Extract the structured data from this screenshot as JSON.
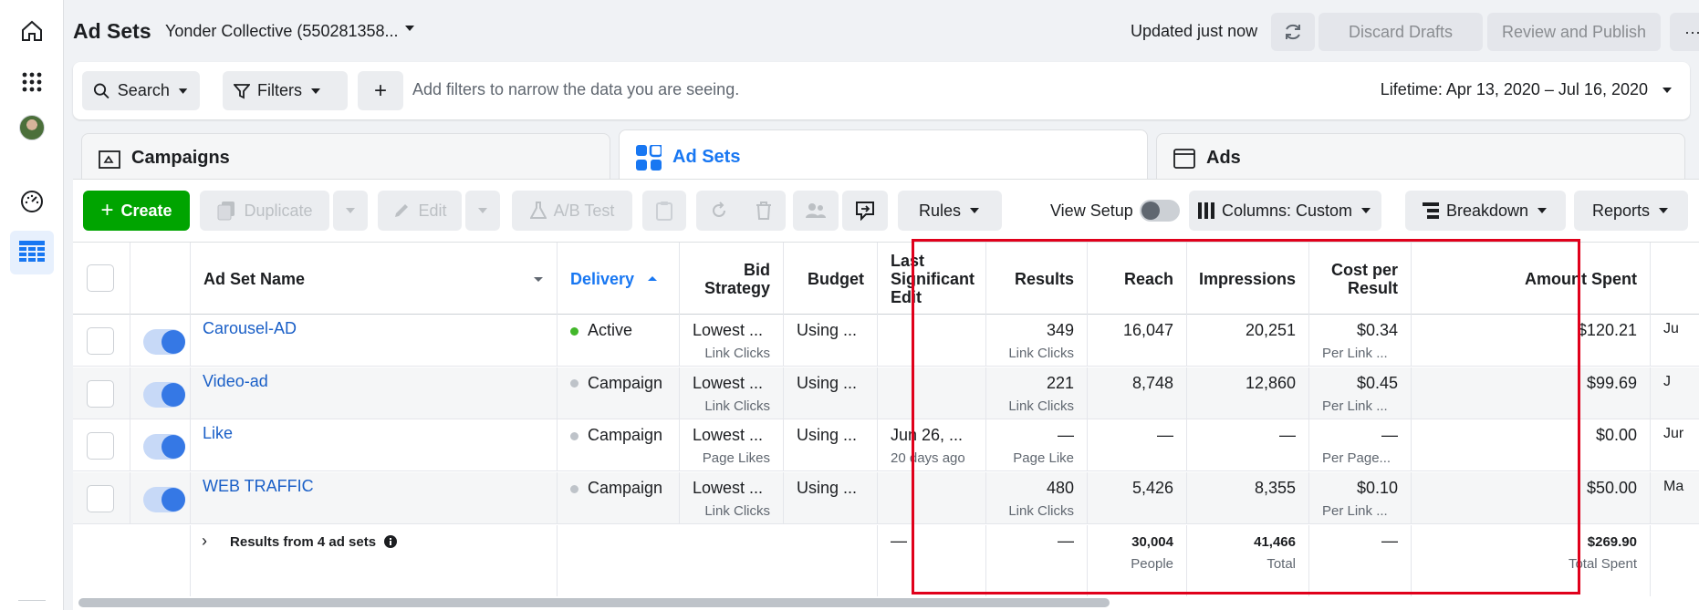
{
  "header": {
    "title": "Ad Sets",
    "account": "Yonder Collective (550281358...",
    "status": "Updated just now",
    "discard_label": "Discard Drafts",
    "review_label": "Review and Publish",
    "more_label": "···"
  },
  "filters": {
    "search_label": "Search",
    "filters_label": "Filters",
    "add_label": "+",
    "hint": "Add filters to narrow the data you are seeing.",
    "date_range": "Lifetime: Apr 13, 2020 – Jul 16, 2020"
  },
  "tabs": [
    {
      "label": "Campaigns"
    },
    {
      "label": "Ad Sets"
    },
    {
      "label": "Ads"
    }
  ],
  "toolbar": {
    "create": "Create",
    "duplicate": "Duplicate",
    "edit": "Edit",
    "ab_test": "A/B Test",
    "rules": "Rules",
    "view_setup": "View Setup",
    "columns": "Columns: Custom",
    "breakdown": "Breakdown",
    "reports": "Reports"
  },
  "columns": {
    "name": "Ad Set Name",
    "delivery": "Delivery",
    "bid": "Bid Strategy",
    "budget": "Budget",
    "last_edit": "Last Significant Edit",
    "results": "Results",
    "reach": "Reach",
    "impressions": "Impressions",
    "cpr": "Cost per Result",
    "spent": "Amount Spent"
  },
  "rows": [
    {
      "name": "Carousel-AD",
      "delivery": "Active",
      "delivery_color": "#42b72a",
      "bid": "Lowest ...",
      "bid_sub": "Link Clicks",
      "budget": "Using ...",
      "edit": "",
      "edit_sub": "",
      "results": "349",
      "results_sub": "Link Clicks",
      "reach": "16,047",
      "impressions": "20,251",
      "cpr": "$0.34",
      "cpr_sub": "Per Link ...",
      "spent": "$120.21",
      "extra": "Ju"
    },
    {
      "name": "Video-ad",
      "delivery": "Campaign",
      "delivery_color": "#bec3c9",
      "bid": "Lowest ...",
      "bid_sub": "Link Clicks",
      "budget": "Using ...",
      "edit": "",
      "edit_sub": "",
      "results": "221",
      "results_sub": "Link Clicks",
      "reach": "8,748",
      "impressions": "12,860",
      "cpr": "$0.45",
      "cpr_sub": "Per Link ...",
      "spent": "$99.69",
      "extra": "J"
    },
    {
      "name": "Like",
      "delivery": "Campaign",
      "delivery_color": "#bec3c9",
      "bid": "Lowest ...",
      "bid_sub": "Page Likes",
      "budget": "Using ...",
      "edit": "Jun 26, ...",
      "edit_sub": "20 days ago",
      "results": "—",
      "results_sub": "Page Like",
      "reach": "—",
      "impressions": "—",
      "cpr": "—",
      "cpr_sub": "Per Page...",
      "spent": "$0.00",
      "extra": "Jur"
    },
    {
      "name": "WEB TRAFFIC",
      "delivery": "Campaign",
      "delivery_color": "#bec3c9",
      "bid": "Lowest ...",
      "bid_sub": "Link Clicks",
      "budget": "Using ...",
      "edit": "",
      "edit_sub": "",
      "results": "480",
      "results_sub": "Link Clicks",
      "reach": "5,426",
      "impressions": "8,355",
      "cpr": "$0.10",
      "cpr_sub": "Per Link ...",
      "spent": "$50.00",
      "extra": "Ma"
    }
  ],
  "summary": {
    "label": "Results from 4 ad sets",
    "edit": "—",
    "results": "—",
    "reach": "30,004",
    "reach_sub": "People",
    "impressions": "41,466",
    "impressions_sub": "Total",
    "cpr": "—",
    "spent": "$269.90",
    "spent_sub": "Total Spent"
  },
  "colors": {
    "accent": "#1877f2",
    "create": "#00a400",
    "highlight": "#e0001b"
  }
}
